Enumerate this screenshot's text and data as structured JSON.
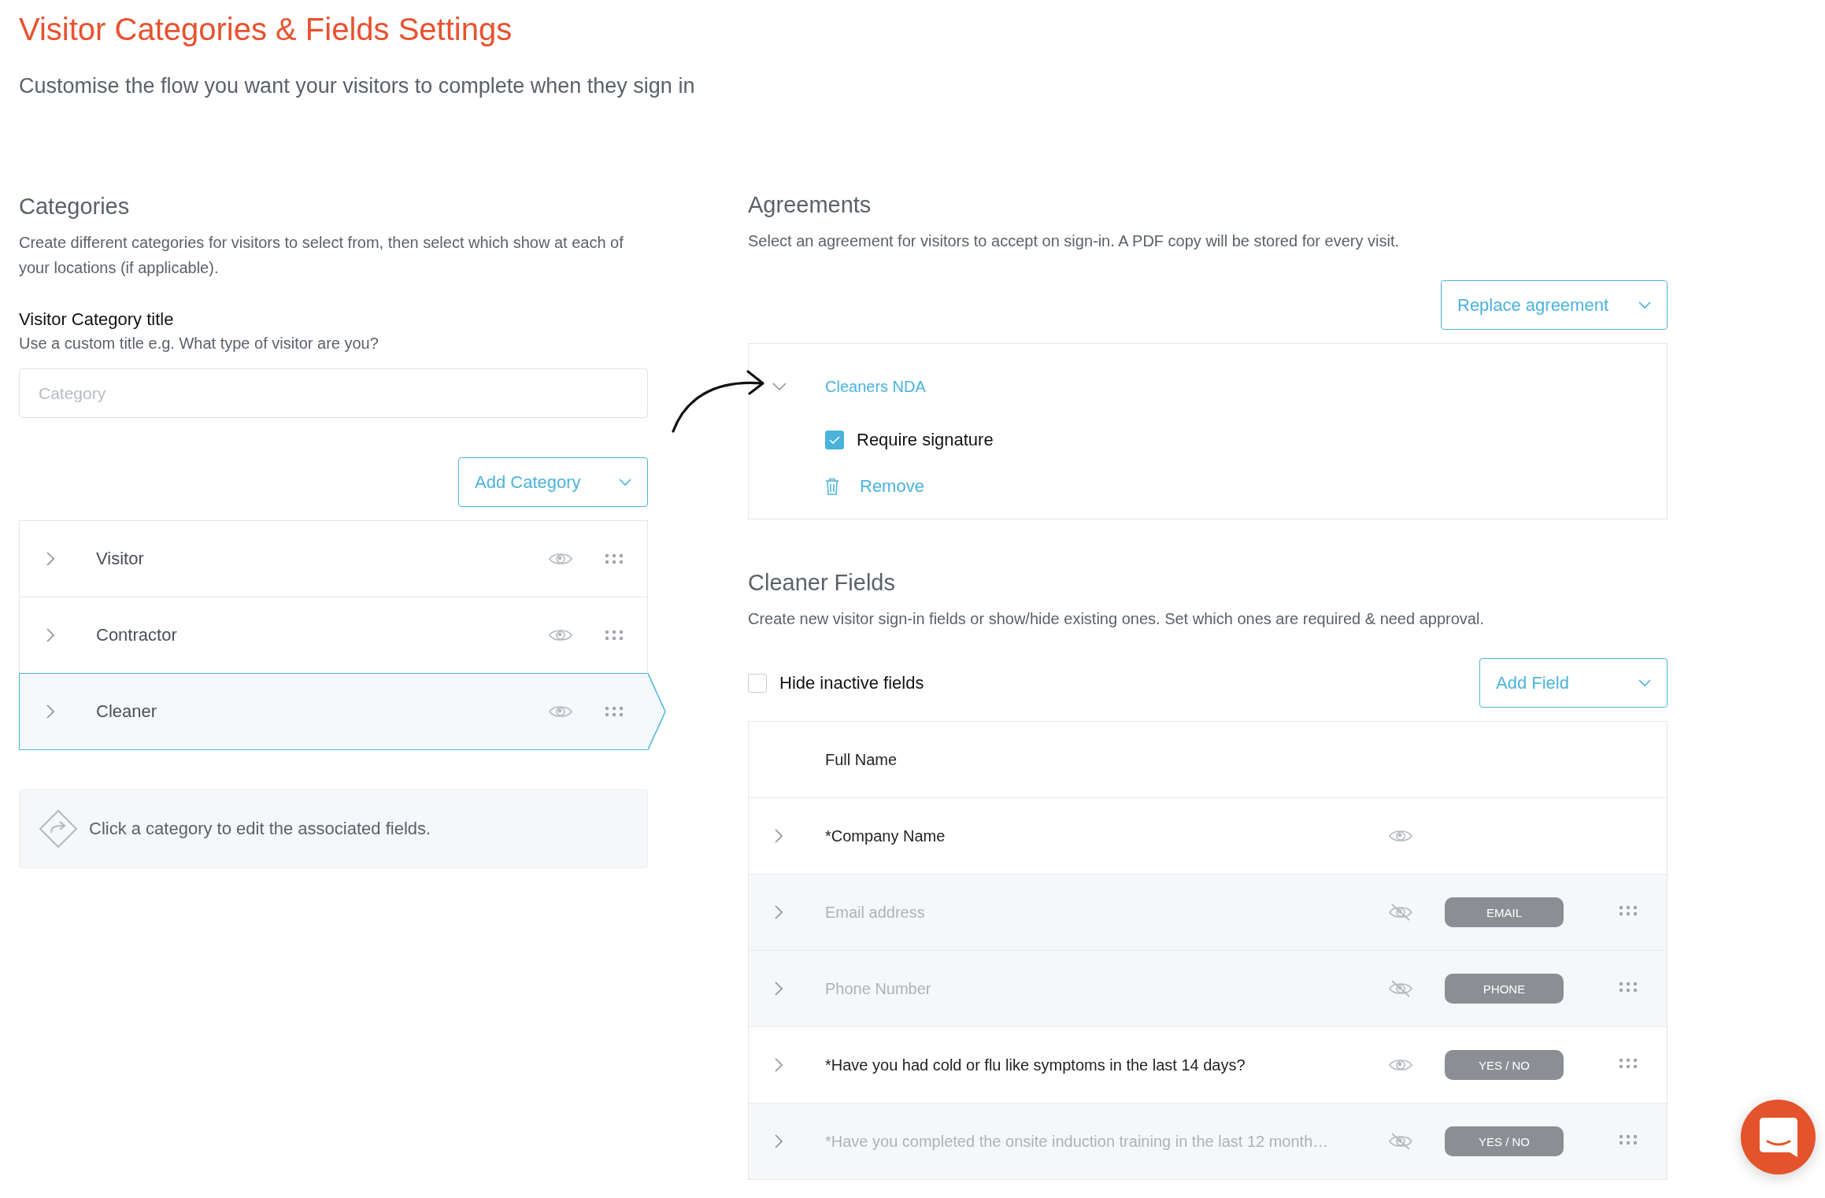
{
  "page": {
    "title": "Visitor Categories & Fields Settings",
    "subtitle": "Customise the flow you want your visitors to complete when they sign in"
  },
  "categories": {
    "heading": "Categories",
    "description": "Create different categories for visitors to select from, then select which show at each of your locations (if applicable).",
    "title_label": "Visitor Category title",
    "title_hint": "Use a custom title e.g. What type of visitor are you?",
    "input": {
      "placeholder": "Category"
    },
    "add_button": "Add Category",
    "items": [
      {
        "name": "Visitor",
        "selected": false
      },
      {
        "name": "Contractor",
        "selected": false
      },
      {
        "name": "Cleaner",
        "selected": true
      }
    ],
    "info": "Click a category to edit the associated fields."
  },
  "agreements": {
    "heading": "Agreements",
    "description": "Select an agreement for visitors to accept on sign-in. A PDF copy will be stored for every visit.",
    "replace_button": "Replace agreement",
    "agreement": {
      "name": "Cleaners NDA",
      "expanded": true,
      "require_signature": {
        "label": "Require signature",
        "checked": true
      },
      "remove": "Remove"
    }
  },
  "fields": {
    "heading": "Cleaner Fields",
    "description": "Create new visitor sign-in fields or show/hide existing ones. Set which ones are required & need approval.",
    "hide_inactive": {
      "label": "Hide inactive fields",
      "checked": false
    },
    "add_button": "Add Field",
    "rows": [
      {
        "label": "Full Name",
        "expandable": false,
        "active": true,
        "show_eye": false,
        "draggable": false
      },
      {
        "label": "*Company Name",
        "expandable": true,
        "active": true,
        "show_eye": true,
        "draggable": false
      },
      {
        "label": "Email address",
        "expandable": true,
        "active": false,
        "show_eye": true,
        "tag": "EMAIL",
        "draggable": true
      },
      {
        "label": "Phone Number",
        "expandable": true,
        "active": false,
        "show_eye": true,
        "tag": "PHONE",
        "draggable": true
      },
      {
        "label": "*Have you had cold or flu like symptoms in the last 14 days?",
        "expandable": true,
        "active": true,
        "show_eye": true,
        "tag": "YES / NO",
        "draggable": true
      },
      {
        "label": "*Have you completed the onsite induction training in the last 12 month…",
        "expandable": true,
        "active": false,
        "show_eye": true,
        "tag": "YES / NO",
        "draggable": true
      }
    ]
  }
}
